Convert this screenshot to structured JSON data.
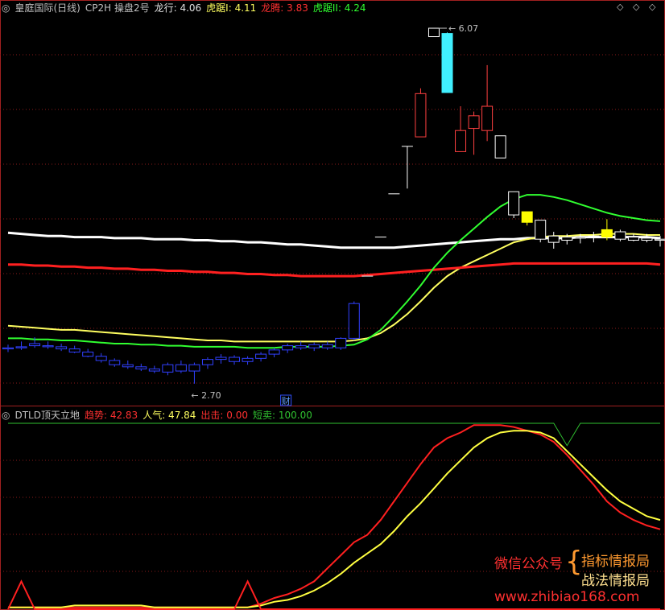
{
  "header_top": {
    "ctrl_icon": "◎",
    "title": "皇庭国际(日线)",
    "indicator": "CP2H 操盘2号",
    "items": [
      {
        "label": "龙行: ",
        "value": "4.06",
        "color": "#e0e0e0"
      },
      {
        "label": "虎踞I: ",
        "value": "4.11",
        "color": "#ffff60"
      },
      {
        "label": "龙腾: ",
        "value": "3.83",
        "color": "#ff3030"
      },
      {
        "label": "虎踞II: ",
        "value": "4.24",
        "color": "#30ff30"
      }
    ],
    "top_right_icons": [
      "◇",
      "◇",
      "◇"
    ]
  },
  "header_bottom": {
    "ctrl_icon": "◎",
    "indicator": "DTLD顶天立地",
    "items": [
      {
        "label": "趋势: ",
        "value": "42.83",
        "color": "#ff3030"
      },
      {
        "label": "人气: ",
        "value": "47.84",
        "color": "#ffff60"
      },
      {
        "label": "出击: ",
        "value": "0.00",
        "color": "#ff3030"
      },
      {
        "label": "短卖: ",
        "value": "100.00",
        "color": "#30c030"
      }
    ]
  },
  "annotations": {
    "high": "6.07",
    "low": "2.70",
    "badge": "财"
  },
  "watermark": {
    "left": "微信公众号",
    "brace": "{",
    "line1": "指标情报局",
    "line2": "战法情报局",
    "url": "www.zhibiao168.com"
  },
  "chart_data": [
    {
      "type": "candlestick",
      "colors": {
        "up": "#ff4040",
        "down_blue": "#3040ff",
        "down_white": "#ffffff",
        "highlight": "#ffff00",
        "spike": "#40f0ff"
      },
      "ylim": [
        2.5,
        6.2
      ],
      "candles": [
        {
          "o": 3.04,
          "h": 3.07,
          "l": 3.0,
          "c": 3.03,
          "color": "blue"
        },
        {
          "o": 3.05,
          "h": 3.1,
          "l": 3.02,
          "c": 3.04,
          "color": "blue"
        },
        {
          "o": 3.08,
          "h": 3.14,
          "l": 3.04,
          "c": 3.06,
          "color": "blue"
        },
        {
          "o": 3.06,
          "h": 3.1,
          "l": 3.03,
          "c": 3.05,
          "color": "blue"
        },
        {
          "o": 3.05,
          "h": 3.08,
          "l": 3.01,
          "c": 3.03,
          "color": "blue"
        },
        {
          "o": 3.03,
          "h": 3.06,
          "l": 2.99,
          "c": 3.0,
          "color": "blue"
        },
        {
          "o": 3.0,
          "h": 3.03,
          "l": 2.95,
          "c": 2.96,
          "color": "blue"
        },
        {
          "o": 2.96,
          "h": 2.99,
          "l": 2.9,
          "c": 2.92,
          "color": "blue"
        },
        {
          "o": 2.92,
          "h": 2.94,
          "l": 2.86,
          "c": 2.88,
          "color": "blue"
        },
        {
          "o": 2.88,
          "h": 2.92,
          "l": 2.84,
          "c": 2.86,
          "color": "blue"
        },
        {
          "o": 2.86,
          "h": 2.89,
          "l": 2.82,
          "c": 2.84,
          "color": "blue"
        },
        {
          "o": 2.84,
          "h": 2.87,
          "l": 2.8,
          "c": 2.82,
          "color": "blue"
        },
        {
          "o": 2.81,
          "h": 2.9,
          "l": 2.78,
          "c": 2.88,
          "color": "blue"
        },
        {
          "o": 2.88,
          "h": 2.92,
          "l": 2.8,
          "c": 2.82,
          "color": "blue"
        },
        {
          "o": 2.82,
          "h": 2.9,
          "l": 2.7,
          "c": 2.88,
          "color": "blue"
        },
        {
          "o": 2.88,
          "h": 2.95,
          "l": 2.84,
          "c": 2.93,
          "color": "blue"
        },
        {
          "o": 2.93,
          "h": 2.98,
          "l": 2.89,
          "c": 2.95,
          "color": "blue"
        },
        {
          "o": 2.95,
          "h": 2.97,
          "l": 2.88,
          "c": 2.91,
          "color": "blue"
        },
        {
          "o": 2.91,
          "h": 2.96,
          "l": 2.88,
          "c": 2.94,
          "color": "blue"
        },
        {
          "o": 2.94,
          "h": 3.0,
          "l": 2.91,
          "c": 2.98,
          "color": "blue"
        },
        {
          "o": 2.98,
          "h": 3.04,
          "l": 2.95,
          "c": 3.02,
          "color": "blue"
        },
        {
          "o": 3.02,
          "h": 3.08,
          "l": 2.99,
          "c": 3.06,
          "color": "blue"
        },
        {
          "o": 3.06,
          "h": 3.1,
          "l": 3.02,
          "c": 3.04,
          "color": "blue"
        },
        {
          "o": 3.04,
          "h": 3.09,
          "l": 3.01,
          "c": 3.07,
          "color": "blue"
        },
        {
          "o": 3.07,
          "h": 3.1,
          "l": 3.02,
          "c": 3.04,
          "color": "blue"
        },
        {
          "o": 3.04,
          "h": 3.14,
          "l": 3.02,
          "c": 3.13,
          "color": "blue"
        },
        {
          "o": 3.13,
          "h": 3.48,
          "l": 3.11,
          "c": 3.46,
          "color": "blue"
        },
        {
          "o": 3.72,
          "h": 3.72,
          "l": 3.72,
          "c": 3.72,
          "color": "white"
        },
        {
          "o": 4.09,
          "h": 4.09,
          "l": 4.09,
          "c": 4.09,
          "color": "white"
        },
        {
          "o": 4.5,
          "h": 4.5,
          "l": 4.5,
          "c": 4.5,
          "color": "white"
        },
        {
          "o": 4.95,
          "h": 4.95,
          "l": 4.55,
          "c": 4.95,
          "color": "white"
        },
        {
          "o": 5.04,
          "h": 5.5,
          "l": 5.04,
          "c": 5.45,
          "color": "red"
        },
        {
          "o": 5.99,
          "h": 6.07,
          "l": 5.99,
          "c": 6.07,
          "color": "white"
        },
        {
          "o": 5.46,
          "h": 6.03,
          "l": 5.46,
          "c": 6.02,
          "color": "spike"
        },
        {
          "o": 4.9,
          "h": 5.33,
          "l": 4.9,
          "c": 5.1,
          "color": "red"
        },
        {
          "o": 5.12,
          "h": 5.28,
          "l": 4.87,
          "c": 5.24,
          "color": "red"
        },
        {
          "o": 5.1,
          "h": 5.72,
          "l": 5.0,
          "c": 5.33,
          "color": "red"
        },
        {
          "o": 5.05,
          "h": 5.05,
          "l": 4.84,
          "c": 4.84,
          "color": "white"
        },
        {
          "o": 4.52,
          "h": 4.52,
          "l": 4.27,
          "c": 4.3,
          "color": "white"
        },
        {
          "o": 4.33,
          "h": 4.33,
          "l": 4.2,
          "c": 4.23,
          "color": "highlight"
        },
        {
          "o": 4.25,
          "h": 4.25,
          "l": 4.04,
          "c": 4.07,
          "color": "white"
        },
        {
          "o": 4.1,
          "h": 4.14,
          "l": 3.98,
          "c": 4.04,
          "color": "white"
        },
        {
          "o": 4.09,
          "h": 4.12,
          "l": 4.02,
          "c": 4.06,
          "color": "white"
        },
        {
          "o": 4.09,
          "h": 4.12,
          "l": 4.03,
          "c": 4.08,
          "color": "white"
        },
        {
          "o": 4.1,
          "h": 4.14,
          "l": 4.04,
          "c": 4.1,
          "color": "white"
        },
        {
          "o": 4.09,
          "h": 4.26,
          "l": 4.06,
          "c": 4.16,
          "color": "highlight"
        },
        {
          "o": 4.14,
          "h": 4.16,
          "l": 4.05,
          "c": 4.07,
          "color": "white"
        },
        {
          "o": 4.09,
          "h": 4.12,
          "l": 4.05,
          "c": 4.06,
          "color": "white"
        },
        {
          "o": 4.08,
          "h": 4.12,
          "l": 4.04,
          "c": 4.06,
          "color": "white"
        },
        {
          "o": 4.07,
          "h": 4.1,
          "l": 4.0,
          "c": 4.06,
          "color": "white"
        }
      ],
      "series": [
        {
          "name": "龙行",
          "color": "#ffffff",
          "values": [
            4.13,
            4.12,
            4.11,
            4.1,
            4.1,
            4.09,
            4.09,
            4.09,
            4.08,
            4.08,
            4.08,
            4.07,
            4.07,
            4.07,
            4.06,
            4.06,
            4.05,
            4.05,
            4.04,
            4.04,
            4.03,
            4.02,
            4.02,
            4.01,
            4.0,
            3.99,
            3.99,
            3.99,
            3.99,
            3.99,
            4.0,
            4.01,
            4.02,
            4.03,
            4.04,
            4.05,
            4.06,
            4.07,
            4.07,
            4.08,
            4.08,
            4.08,
            4.08,
            4.09,
            4.09,
            4.09,
            4.09,
            4.09,
            4.09,
            4.08
          ]
        },
        {
          "name": "虎踞I",
          "color": "#ffff60",
          "values": [
            3.25,
            3.24,
            3.23,
            3.22,
            3.21,
            3.21,
            3.2,
            3.19,
            3.18,
            3.17,
            3.16,
            3.15,
            3.14,
            3.13,
            3.12,
            3.11,
            3.11,
            3.1,
            3.1,
            3.1,
            3.1,
            3.1,
            3.1,
            3.1,
            3.1,
            3.1,
            3.11,
            3.13,
            3.18,
            3.26,
            3.36,
            3.48,
            3.61,
            3.72,
            3.8,
            3.86,
            3.92,
            3.98,
            4.04,
            4.07,
            4.09,
            4.1,
            4.1,
            4.11,
            4.11,
            4.12,
            4.12,
            4.12,
            4.11,
            4.11
          ]
        },
        {
          "name": "龙腾",
          "color": "#ff2020",
          "values": [
            3.83,
            3.83,
            3.82,
            3.82,
            3.81,
            3.81,
            3.8,
            3.8,
            3.79,
            3.79,
            3.78,
            3.78,
            3.77,
            3.77,
            3.76,
            3.76,
            3.75,
            3.75,
            3.74,
            3.74,
            3.73,
            3.73,
            3.72,
            3.72,
            3.72,
            3.72,
            3.72,
            3.73,
            3.74,
            3.75,
            3.76,
            3.77,
            3.78,
            3.79,
            3.8,
            3.81,
            3.82,
            3.83,
            3.84,
            3.84,
            3.84,
            3.84,
            3.84,
            3.84,
            3.84,
            3.84,
            3.84,
            3.84,
            3.84,
            3.83
          ]
        },
        {
          "name": "虎踞II",
          "color": "#30ff30",
          "values": [
            3.13,
            3.13,
            3.12,
            3.12,
            3.11,
            3.11,
            3.1,
            3.09,
            3.08,
            3.08,
            3.07,
            3.07,
            3.06,
            3.06,
            3.05,
            3.05,
            3.05,
            3.05,
            3.04,
            3.04,
            3.04,
            3.05,
            3.05,
            3.05,
            3.05,
            3.06,
            3.07,
            3.12,
            3.21,
            3.34,
            3.48,
            3.63,
            3.8,
            3.94,
            4.06,
            4.17,
            4.28,
            4.38,
            4.45,
            4.49,
            4.49,
            4.47,
            4.44,
            4.4,
            4.36,
            4.32,
            4.29,
            4.27,
            4.25,
            4.24
          ]
        }
      ]
    },
    {
      "type": "line",
      "ylim": [
        0,
        100
      ],
      "series": [
        {
          "name": "趋势",
          "color": "#ff2020",
          "values": [
            1,
            1,
            1,
            1,
            1,
            1,
            1,
            1,
            1,
            1,
            1,
            1,
            1,
            1,
            1,
            1,
            1,
            1,
            1,
            3,
            6,
            8,
            11,
            15,
            22,
            29,
            36,
            40,
            48,
            58,
            68,
            78,
            87,
            92,
            95,
            99,
            99,
            99,
            98,
            96,
            94,
            90,
            83,
            75,
            67,
            58,
            52,
            48,
            45,
            43
          ]
        },
        {
          "name": "人气",
          "color": "#ffff40",
          "values": [
            1,
            1,
            1,
            1,
            1,
            2,
            2,
            2,
            2,
            2,
            2,
            1,
            1,
            1,
            1,
            1,
            1,
            1,
            1,
            2,
            4,
            5,
            7,
            10,
            14,
            19,
            25,
            30,
            35,
            42,
            50,
            57,
            65,
            73,
            80,
            87,
            92,
            95,
            96,
            96,
            95,
            92,
            85,
            78,
            71,
            64,
            58,
            54,
            50,
            48
          ]
        },
        {
          "name": "出击",
          "color": "#ff2020",
          "values": [
            0,
            15,
            0,
            0,
            0,
            0,
            0,
            0,
            0,
            0,
            0,
            0,
            0,
            0,
            0,
            0,
            0,
            0,
            15,
            0,
            0,
            0,
            0,
            0,
            0,
            0,
            0,
            0,
            0,
            0,
            0,
            0,
            0,
            0,
            0,
            0,
            0,
            0,
            0,
            0,
            0,
            0,
            0,
            0,
            0,
            0,
            0,
            0,
            0,
            0
          ]
        },
        {
          "name": "短卖",
          "color": "#30c030",
          "values": [
            100,
            100,
            100,
            100,
            100,
            100,
            100,
            100,
            100,
            100,
            100,
            100,
            100,
            100,
            100,
            100,
            100,
            100,
            100,
            100,
            100,
            100,
            100,
            100,
            100,
            100,
            100,
            100,
            100,
            100,
            100,
            100,
            100,
            100,
            100,
            100,
            100,
            100,
            100,
            100,
            100,
            100,
            88,
            100,
            100,
            100,
            100,
            100,
            100,
            100
          ]
        }
      ]
    }
  ]
}
